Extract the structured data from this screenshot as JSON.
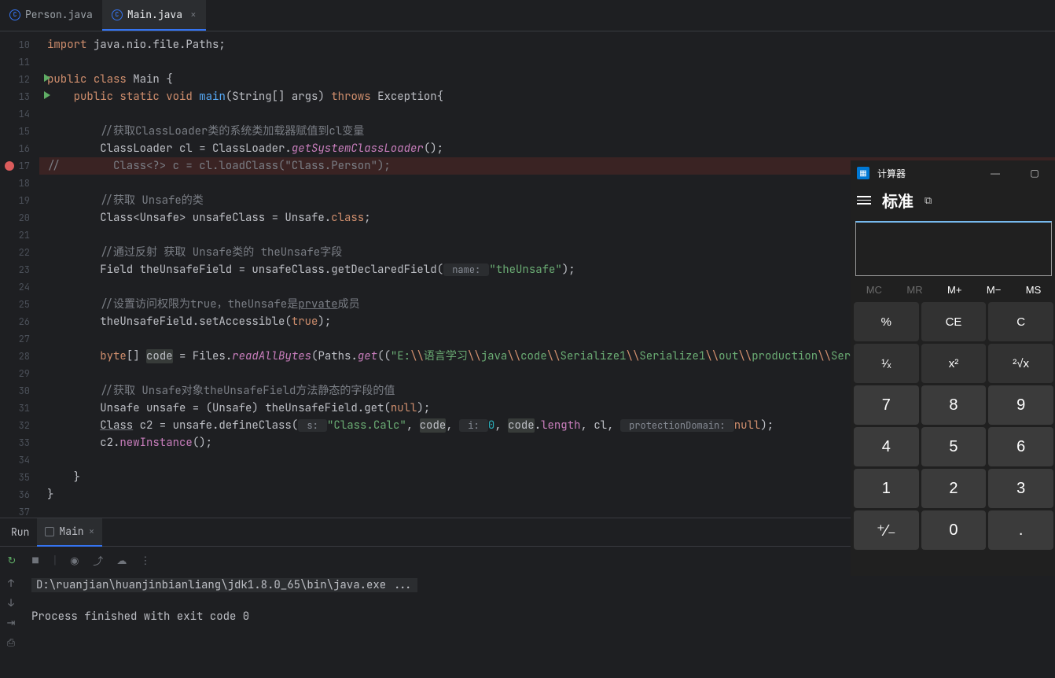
{
  "tabs": [
    {
      "label": "Person.java",
      "active": false
    },
    {
      "label": "Main.java",
      "active": true
    }
  ],
  "gutter": {
    "start": 10,
    "count": 28,
    "run_markers": [
      12,
      13
    ],
    "breakpoint": 17
  },
  "code": {
    "l10": {
      "kw1": "import",
      "rest": " java.nio.file.Paths;"
    },
    "l12": {
      "kw1": "public",
      "kw2": "class",
      "name": " Main {"
    },
    "l13": {
      "kw1": "public",
      "kw2": "static",
      "kw3": "void",
      "fn": "main",
      "args": "(String[] args) ",
      "kw4": "throws",
      "rest": " Exception{"
    },
    "l15": "//获取ClassLoader类的系统类加载器赋值到cl变量",
    "l16": {
      "pre": "ClassLoader cl = ClassLoader.",
      "fn": "getSystemClassLoader",
      "post": "();"
    },
    "l17": "//        Class<?> c = cl.loadClass(\"Class.Person\");",
    "l19": "//获取 Unsafe的类",
    "l20": {
      "pre": "Class<Unsafe> unsafeClass = Unsafe.",
      "kw": "class",
      "post": ";"
    },
    "l22": "//通过反射 获取 Unsafe类的 theUnsafe字段",
    "l23": {
      "pre": "Field theUnsafeField = unsafeClass.getDeclaredField(",
      "hint": " name: ",
      "str": "\"theUnsafe\"",
      "post": ");"
    },
    "l25_a": "//设置访问权限为true，theUnsafe是",
    "l25_b": "prvate",
    "l25_c": "成员",
    "l26": {
      "pre": "theUnsafeField.setAccessible(",
      "kw": "true",
      "post": ");"
    },
    "l28": {
      "kw": "byte",
      "br": "[] ",
      "hl": "code",
      "eq": " = Files.",
      "fn": "readAllBytes",
      "par": "(Paths.",
      "fn2": "get",
      "open": "((",
      "s1": "\"E:",
      "e1": "\\\\",
      "s2": "语言学习",
      "e2": "\\\\",
      "s3": "java",
      "e3": "\\\\",
      "s4": "code",
      "e4": "\\\\",
      "s5": "Serialize1",
      "e5": "\\\\",
      "s6": "Serialize1",
      "e6": "\\\\",
      "s7": "out",
      "e7": "\\\\",
      "s8": "production",
      "e8": "\\\\",
      "s9": "Serialize"
    },
    "l30": "//获取 Unsafe对象theUnsafeField方法静态的字段的值",
    "l31": {
      "pre": "Unsafe unsafe = (Unsafe) theUnsafeField.get(",
      "kw": "null",
      "post": ");"
    },
    "l32": {
      "cls": "Class",
      "pre": " c2 = unsafe.defineClass(",
      "h1": " s: ",
      "str": "\"Class.Calc\"",
      "c1": ", ",
      "hl1": "code",
      "c2": ", ",
      "h2": " i: ",
      "n": "0",
      "c3": ", ",
      "hl2": "code",
      "dot": ".",
      "len": "length",
      "c4": ", cl, ",
      "h3": " protectionDomain: ",
      "kw": "null",
      "post": ");"
    },
    "l33": {
      "pre": "c2.",
      "fn": "newInstance",
      "post": "();"
    },
    "l35": "}",
    "l36": "}"
  },
  "run": {
    "title": "Run",
    "tab": "Main",
    "cmd": "D:\\ruanjian\\huanjinbianliang\\jdk1.8.0_65\\bin\\java.exe ...",
    "out": "Process finished with exit code 0"
  },
  "calc": {
    "title": "计算器",
    "mode": "标准",
    "mem": [
      "MC",
      "MR",
      "M+",
      "M−",
      "MS"
    ],
    "keys": [
      {
        "l": "%",
        "c": ""
      },
      {
        "l": "CE",
        "c": ""
      },
      {
        "l": "C",
        "c": ""
      },
      {
        "l": "¹⁄ₓ",
        "c": ""
      },
      {
        "l": "x²",
        "c": ""
      },
      {
        "l": "²√x",
        "c": ""
      },
      {
        "l": "7",
        "c": "num"
      },
      {
        "l": "8",
        "c": "num"
      },
      {
        "l": "9",
        "c": "num"
      },
      {
        "l": "4",
        "c": "num"
      },
      {
        "l": "5",
        "c": "num"
      },
      {
        "l": "6",
        "c": "num"
      },
      {
        "l": "1",
        "c": "num"
      },
      {
        "l": "2",
        "c": "num"
      },
      {
        "l": "3",
        "c": "num"
      },
      {
        "l": "⁺⁄₋",
        "c": "num"
      },
      {
        "l": "0",
        "c": "num"
      },
      {
        "l": ".",
        "c": "num"
      }
    ]
  }
}
